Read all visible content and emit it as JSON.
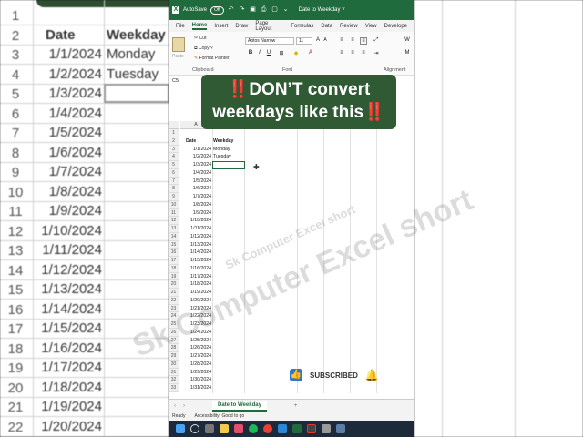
{
  "bg_left": {
    "rows": [
      {
        "num": "1",
        "date": "",
        "weekday": ""
      },
      {
        "num": "2",
        "date": "Date",
        "weekday": "Weekday"
      },
      {
        "num": "3",
        "date": "1/1/2024",
        "weekday": "Monday"
      },
      {
        "num": "4",
        "date": "1/2/2024",
        "weekday": "Tuesday"
      },
      {
        "num": "5",
        "date": "1/3/2024",
        "weekday": ""
      },
      {
        "num": "6",
        "date": "1/4/2024",
        "weekday": ""
      },
      {
        "num": "7",
        "date": "1/5/2024",
        "weekday": ""
      },
      {
        "num": "8",
        "date": "1/6/2024",
        "weekday": ""
      },
      {
        "num": "9",
        "date": "1/7/2024",
        "weekday": ""
      },
      {
        "num": "10",
        "date": "1/8/2024",
        "weekday": ""
      },
      {
        "num": "11",
        "date": "1/9/2024",
        "weekday": ""
      },
      {
        "num": "12",
        "date": "1/10/2024",
        "weekday": ""
      },
      {
        "num": "13",
        "date": "1/11/2024",
        "weekday": ""
      },
      {
        "num": "14",
        "date": "1/12/2024",
        "weekday": ""
      },
      {
        "num": "15",
        "date": "1/13/2024",
        "weekday": ""
      },
      {
        "num": "16",
        "date": "1/14/2024",
        "weekday": ""
      },
      {
        "num": "17",
        "date": "1/15/2024",
        "weekday": ""
      },
      {
        "num": "18",
        "date": "1/16/2024",
        "weekday": ""
      },
      {
        "num": "19",
        "date": "1/17/2024",
        "weekday": ""
      },
      {
        "num": "20",
        "date": "1/18/2024",
        "weekday": ""
      },
      {
        "num": "21",
        "date": "1/19/2024",
        "weekday": ""
      },
      {
        "num": "22",
        "date": "1/20/2024",
        "weekday": ""
      }
    ]
  },
  "titlebar": {
    "autosave_label": "AutoSave",
    "toggle_label": "Off",
    "file_name": "Date to Weekday ˅"
  },
  "menu": [
    "File",
    "Home",
    "Insert",
    "Draw",
    "Page Layout",
    "Formulas",
    "Data",
    "Review",
    "View",
    "Develope"
  ],
  "ribbon": {
    "paste_label": "Paste",
    "cut_label": "Cut",
    "copy_label": "Copy ˅",
    "format_painter_label": "Format Painter",
    "clipboard_label": "Clipboard",
    "font_name": "Aptos Narrow",
    "font_size": "11",
    "font_label": "Font",
    "alignment_label": "Alignment",
    "wrap_label": "W",
    "merge_label": "M"
  },
  "formula_bar": {
    "name_box": "C5"
  },
  "sheet": {
    "columns": [
      "A",
      "B",
      "C",
      "D",
      "E",
      "F",
      "G"
    ],
    "rows": [
      {
        "num": "1",
        "date": "",
        "weekday": ""
      },
      {
        "num": "2",
        "date": "Date",
        "weekday": "Weekday"
      },
      {
        "num": "3",
        "date": "1/1/2024",
        "weekday": "Monday"
      },
      {
        "num": "4",
        "date": "1/2/2024",
        "weekday": "Tuesday"
      },
      {
        "num": "5",
        "date": "1/3/2024",
        "weekday": ""
      },
      {
        "num": "6",
        "date": "1/4/2024",
        "weekday": ""
      },
      {
        "num": "7",
        "date": "1/5/2024",
        "weekday": ""
      },
      {
        "num": "8",
        "date": "1/6/2024",
        "weekday": ""
      },
      {
        "num": "9",
        "date": "1/7/2024",
        "weekday": ""
      },
      {
        "num": "10",
        "date": "1/8/2024",
        "weekday": ""
      },
      {
        "num": "11",
        "date": "1/9/2024",
        "weekday": ""
      },
      {
        "num": "12",
        "date": "1/10/2024",
        "weekday": ""
      },
      {
        "num": "13",
        "date": "1/11/2024",
        "weekday": ""
      },
      {
        "num": "14",
        "date": "1/12/2024",
        "weekday": ""
      },
      {
        "num": "15",
        "date": "1/13/2024",
        "weekday": ""
      },
      {
        "num": "16",
        "date": "1/14/2024",
        "weekday": ""
      },
      {
        "num": "17",
        "date": "1/15/2024",
        "weekday": ""
      },
      {
        "num": "18",
        "date": "1/16/2024",
        "weekday": ""
      },
      {
        "num": "19",
        "date": "1/17/2024",
        "weekday": ""
      },
      {
        "num": "20",
        "date": "1/18/2024",
        "weekday": ""
      },
      {
        "num": "21",
        "date": "1/19/2024",
        "weekday": ""
      },
      {
        "num": "22",
        "date": "1/20/2024",
        "weekday": ""
      },
      {
        "num": "23",
        "date": "1/21/2024",
        "weekday": ""
      },
      {
        "num": "24",
        "date": "1/22/2024",
        "weekday": ""
      },
      {
        "num": "25",
        "date": "1/23/2024",
        "weekday": ""
      },
      {
        "num": "26",
        "date": "1/24/2024",
        "weekday": ""
      },
      {
        "num": "27",
        "date": "1/25/2024",
        "weekday": ""
      },
      {
        "num": "28",
        "date": "1/26/2024",
        "weekday": ""
      },
      {
        "num": "29",
        "date": "1/27/2024",
        "weekday": ""
      },
      {
        "num": "30",
        "date": "1/28/2024",
        "weekday": ""
      },
      {
        "num": "31",
        "date": "1/29/2024",
        "weekday": ""
      },
      {
        "num": "32",
        "date": "1/30/2024",
        "weekday": ""
      },
      {
        "num": "33",
        "date": "1/31/2024",
        "weekday": ""
      }
    ]
  },
  "sheet_tab": "Date to Weekday",
  "add_sheet": "+",
  "status": {
    "ready": "Ready",
    "accessibility": "Accessibility: Good to go"
  },
  "banner": {
    "bang": "‼️",
    "line1": "DON’T convert",
    "line2": "weekdays like this"
  },
  "watermark": "Sk Computer Excel short",
  "subscribe_label": "SUBSCRIBED",
  "colors": {
    "excel_green": "#1f6b3d",
    "banner_green": "#2f5a34",
    "alert_red": "#e02424"
  }
}
